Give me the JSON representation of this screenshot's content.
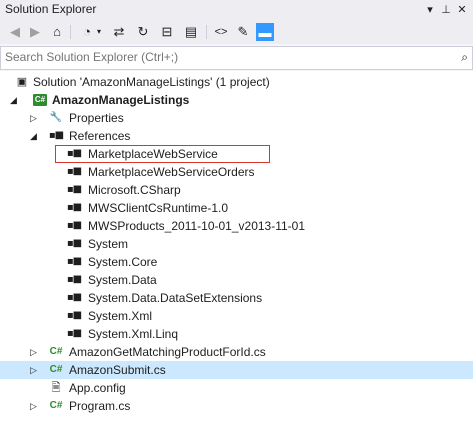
{
  "window": {
    "title": "Solution Explorer",
    "pin_icon": "pin-icon",
    "close_icon": "close-icon",
    "dropdown_icon": "window-position-icon"
  },
  "toolbar": {
    "buttons": [
      {
        "name": "back-icon",
        "glyph": "◀",
        "disabled": true
      },
      {
        "name": "forward-icon",
        "glyph": "▶",
        "disabled": true
      },
      {
        "name": "home-icon",
        "glyph": "⌂",
        "disabled": false
      },
      {
        "name": "pending-changes-filter-icon",
        "glyph": "◔",
        "disabled": false
      },
      {
        "name": "sync-icon",
        "glyph": "⇄",
        "disabled": false
      },
      {
        "name": "refresh-icon",
        "glyph": "↻",
        "disabled": false
      },
      {
        "name": "collapse-all-icon",
        "glyph": "⊟",
        "disabled": false
      },
      {
        "name": "show-all-files-icon",
        "glyph": "▤",
        "disabled": false
      },
      {
        "name": "view-code-icon",
        "glyph": "<>",
        "disabled": false
      },
      {
        "name": "properties-icon",
        "glyph": "🔧",
        "disabled": false
      },
      {
        "name": "preview-selected-icon",
        "glyph": "▬",
        "disabled": false
      }
    ]
  },
  "search": {
    "placeholder": "Search Solution Explorer (Ctrl+;)",
    "icon": "search-icon"
  },
  "tree": {
    "solution": "Solution 'AmazonManageListings' (1 project)",
    "project": "AmazonManageListings",
    "properties": "Properties",
    "references": "References",
    "reference_items": [
      "MarketplaceWebService",
      "MarketplaceWebServiceOrders",
      "Microsoft.CSharp",
      "MWSClientCsRuntime-1.0",
      "MWSProducts_2011-10-01_v2013-11-01",
      "System",
      "System.Core",
      "System.Data",
      "System.Data.DataSetExtensions",
      "System.Xml",
      "System.Xml.Linq"
    ],
    "files": [
      {
        "label": "AmazonGetMatchingProductForId.cs",
        "type": "cs",
        "selected": false
      },
      {
        "label": "AmazonSubmit.cs",
        "type": "cs",
        "selected": true
      },
      {
        "label": "App.config",
        "type": "config",
        "selected": false
      },
      {
        "label": "Program.cs",
        "type": "cs",
        "selected": false
      }
    ]
  }
}
